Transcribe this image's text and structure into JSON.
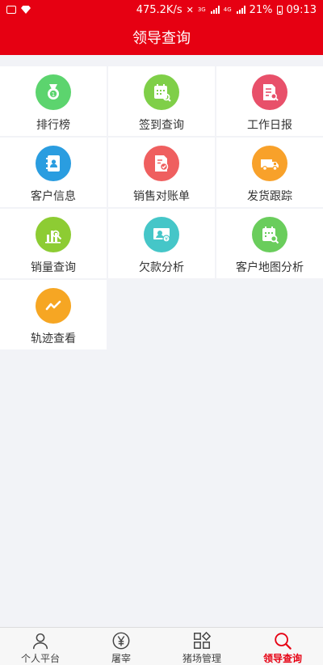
{
  "status_bar": {
    "speed": "475.2K/s",
    "signal_1_label": "3G",
    "signal_2_label": "4G",
    "battery": "21%",
    "time": "09:13"
  },
  "header": {
    "title": "领导查询"
  },
  "menu": [
    {
      "label": "排行榜",
      "icon": "medal-icon",
      "color": "#5cd46e"
    },
    {
      "label": "签到查询",
      "icon": "calendar-search-icon",
      "color": "#7fcf48"
    },
    {
      "label": "工作日报",
      "icon": "report-icon",
      "color": "#e8506a"
    },
    {
      "label": "客户信息",
      "icon": "contacts-book-icon",
      "color": "#2a9de0"
    },
    {
      "label": "销售对账单",
      "icon": "statement-icon",
      "color": "#ef5f5f"
    },
    {
      "label": "发货跟踪",
      "icon": "truck-icon",
      "color": "#f8a12a"
    },
    {
      "label": "销量查询",
      "icon": "sales-chart-icon",
      "color": "#8dcc33"
    },
    {
      "label": "欠款分析",
      "icon": "debt-analysis-icon",
      "color": "#45c6c8"
    },
    {
      "label": "客户地图分析",
      "icon": "map-analysis-icon",
      "color": "#6acd5c"
    },
    {
      "label": "轨迹查看",
      "icon": "trend-icon",
      "color": "#f6a623"
    }
  ],
  "tabbar": {
    "items": [
      {
        "label": "个人平台",
        "icon": "person-icon",
        "active": false
      },
      {
        "label": "屠宰",
        "icon": "yen-icon",
        "active": false
      },
      {
        "label": "猪场管理",
        "icon": "apps-icon",
        "active": false
      },
      {
        "label": "领导查询",
        "icon": "search-icon",
        "active": true
      }
    ],
    "active_color": "#e60012"
  }
}
